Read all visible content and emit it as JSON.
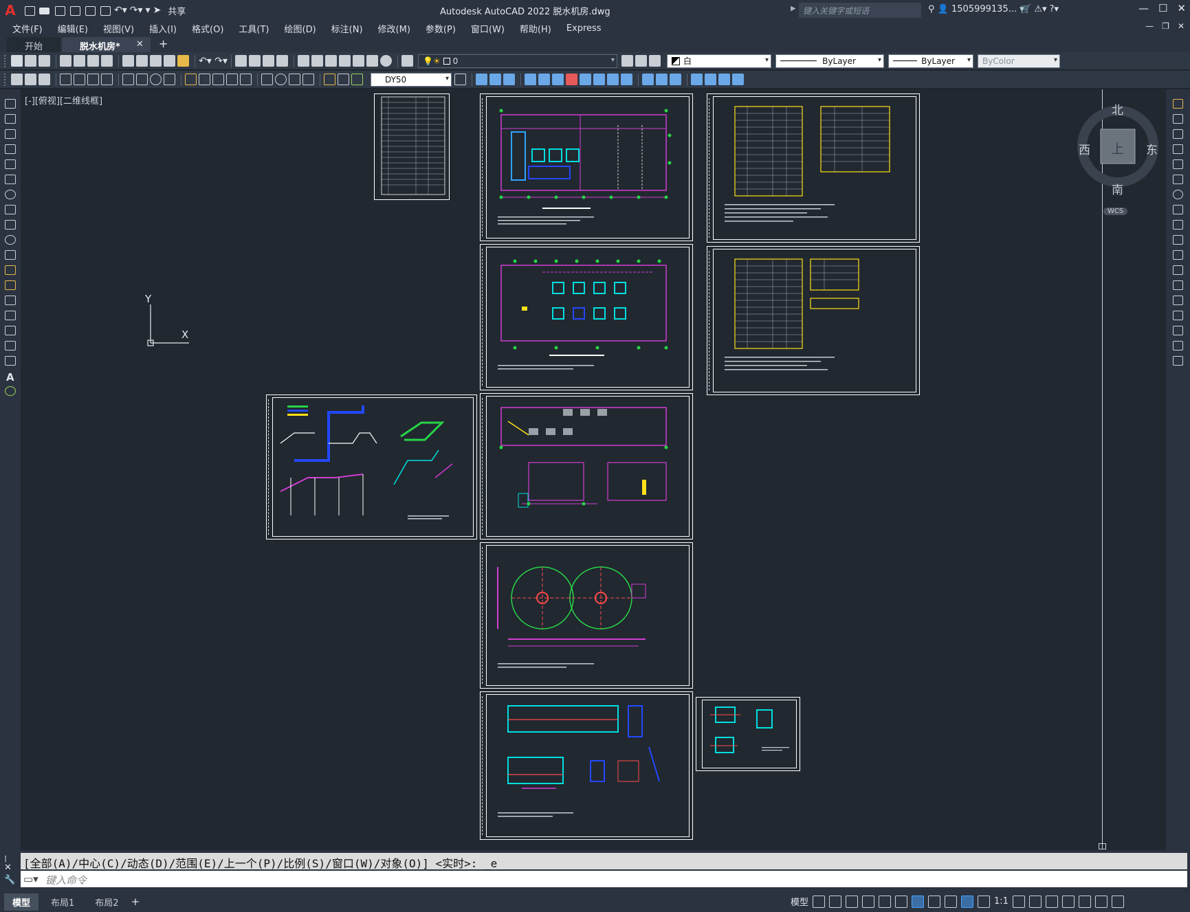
{
  "app": {
    "title": "Autodesk AutoCAD 2022    脱水机房.dwg",
    "logo_letter": "A",
    "share_label": "共享",
    "search_placeholder": "键入关键字或短语",
    "user": "1505999135...",
    "brand_color": "#e3312d"
  },
  "menu": [
    "文件(F)",
    "编辑(E)",
    "视图(V)",
    "插入(I)",
    "格式(O)",
    "工具(T)",
    "绘图(D)",
    "标注(N)",
    "修改(M)",
    "参数(P)",
    "窗口(W)",
    "帮助(H)",
    "Express"
  ],
  "tabs": [
    {
      "label": "开始"
    },
    {
      "label": "脱水机房*"
    }
  ],
  "toolbar": {
    "layer_value": "0",
    "color_value": "白",
    "linetype_value": "ByLayer",
    "lineweight_value": "ByLayer",
    "plotstyle_value": "ByColor",
    "dimstyle_value": "DY50"
  },
  "viewport": {
    "label": "[-][俯视][二维线框]",
    "ucs_x": "X",
    "ucs_y": "Y"
  },
  "navcube": {
    "north": "北",
    "south": "南",
    "east": "东",
    "west": "西",
    "face": "上",
    "wcs": "WCS"
  },
  "command": {
    "history": "[全部(A)/中心(C)/动态(D)/范围(E)/上一个(P)/比例(S)/窗口(W)/对象(O)] <实时>: _e",
    "placeholder": "键入命令"
  },
  "layouts": [
    "模型",
    "布局1",
    "布局2"
  ],
  "status": {
    "model_label": "模型",
    "scale": "1:1"
  }
}
